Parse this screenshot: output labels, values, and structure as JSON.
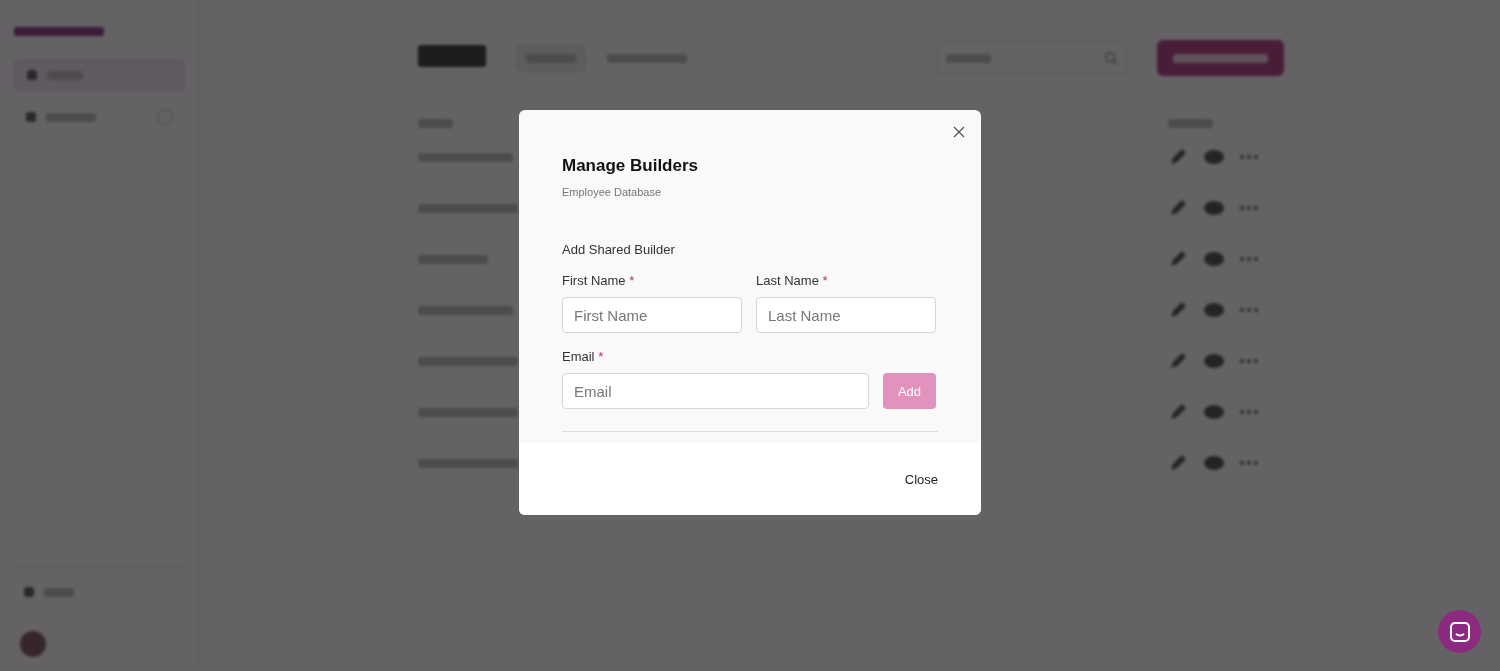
{
  "modal": {
    "title": "Manage Builders",
    "subtitle": "Employee Database",
    "section": "Add Shared Builder",
    "fields": [
      {
        "label": "First Name",
        "required_mark": "*",
        "placeholder": "First Name"
      },
      {
        "label": "Last Name",
        "required_mark": "*",
        "placeholder": "Last Name"
      },
      {
        "label": "Email",
        "required_mark": "*",
        "placeholder": "Email"
      }
    ],
    "add_button": {
      "label": "Add",
      "disabled": true
    },
    "close_button": "Close"
  }
}
